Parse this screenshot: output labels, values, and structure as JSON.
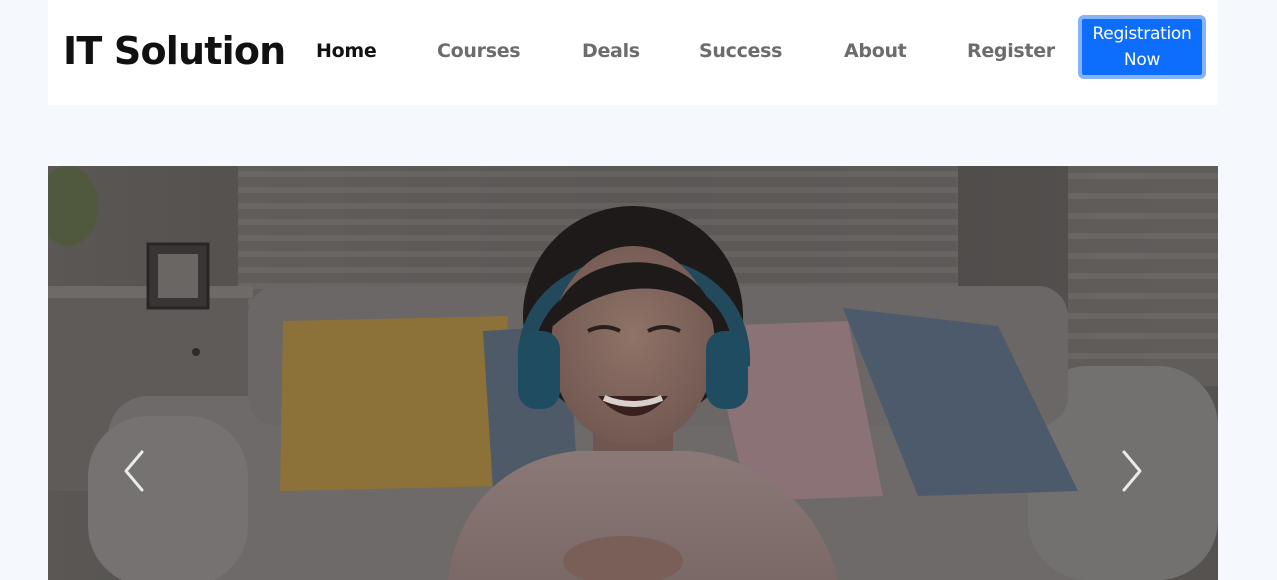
{
  "brand": {
    "name": "IT Solution"
  },
  "nav": {
    "items": [
      {
        "label": "Home",
        "active": true
      },
      {
        "label": "Courses",
        "active": false
      },
      {
        "label": "Deals",
        "active": false
      },
      {
        "label": "Success",
        "active": false
      },
      {
        "label": "About",
        "active": false
      },
      {
        "label": "Register",
        "active": false
      }
    ],
    "cta_line1": "Registration",
    "cta_line2": "Now"
  },
  "carousel": {
    "prev_icon": "chevron-left-icon",
    "next_icon": "chevron-right-icon"
  },
  "colors": {
    "page_bg": "#f5f9fd",
    "nav_bg": "#ffffff",
    "active_link": "#111111",
    "link": "#6c6c6c",
    "cta_bg": "#0d6efd",
    "cta_border": "#86b3f6"
  }
}
